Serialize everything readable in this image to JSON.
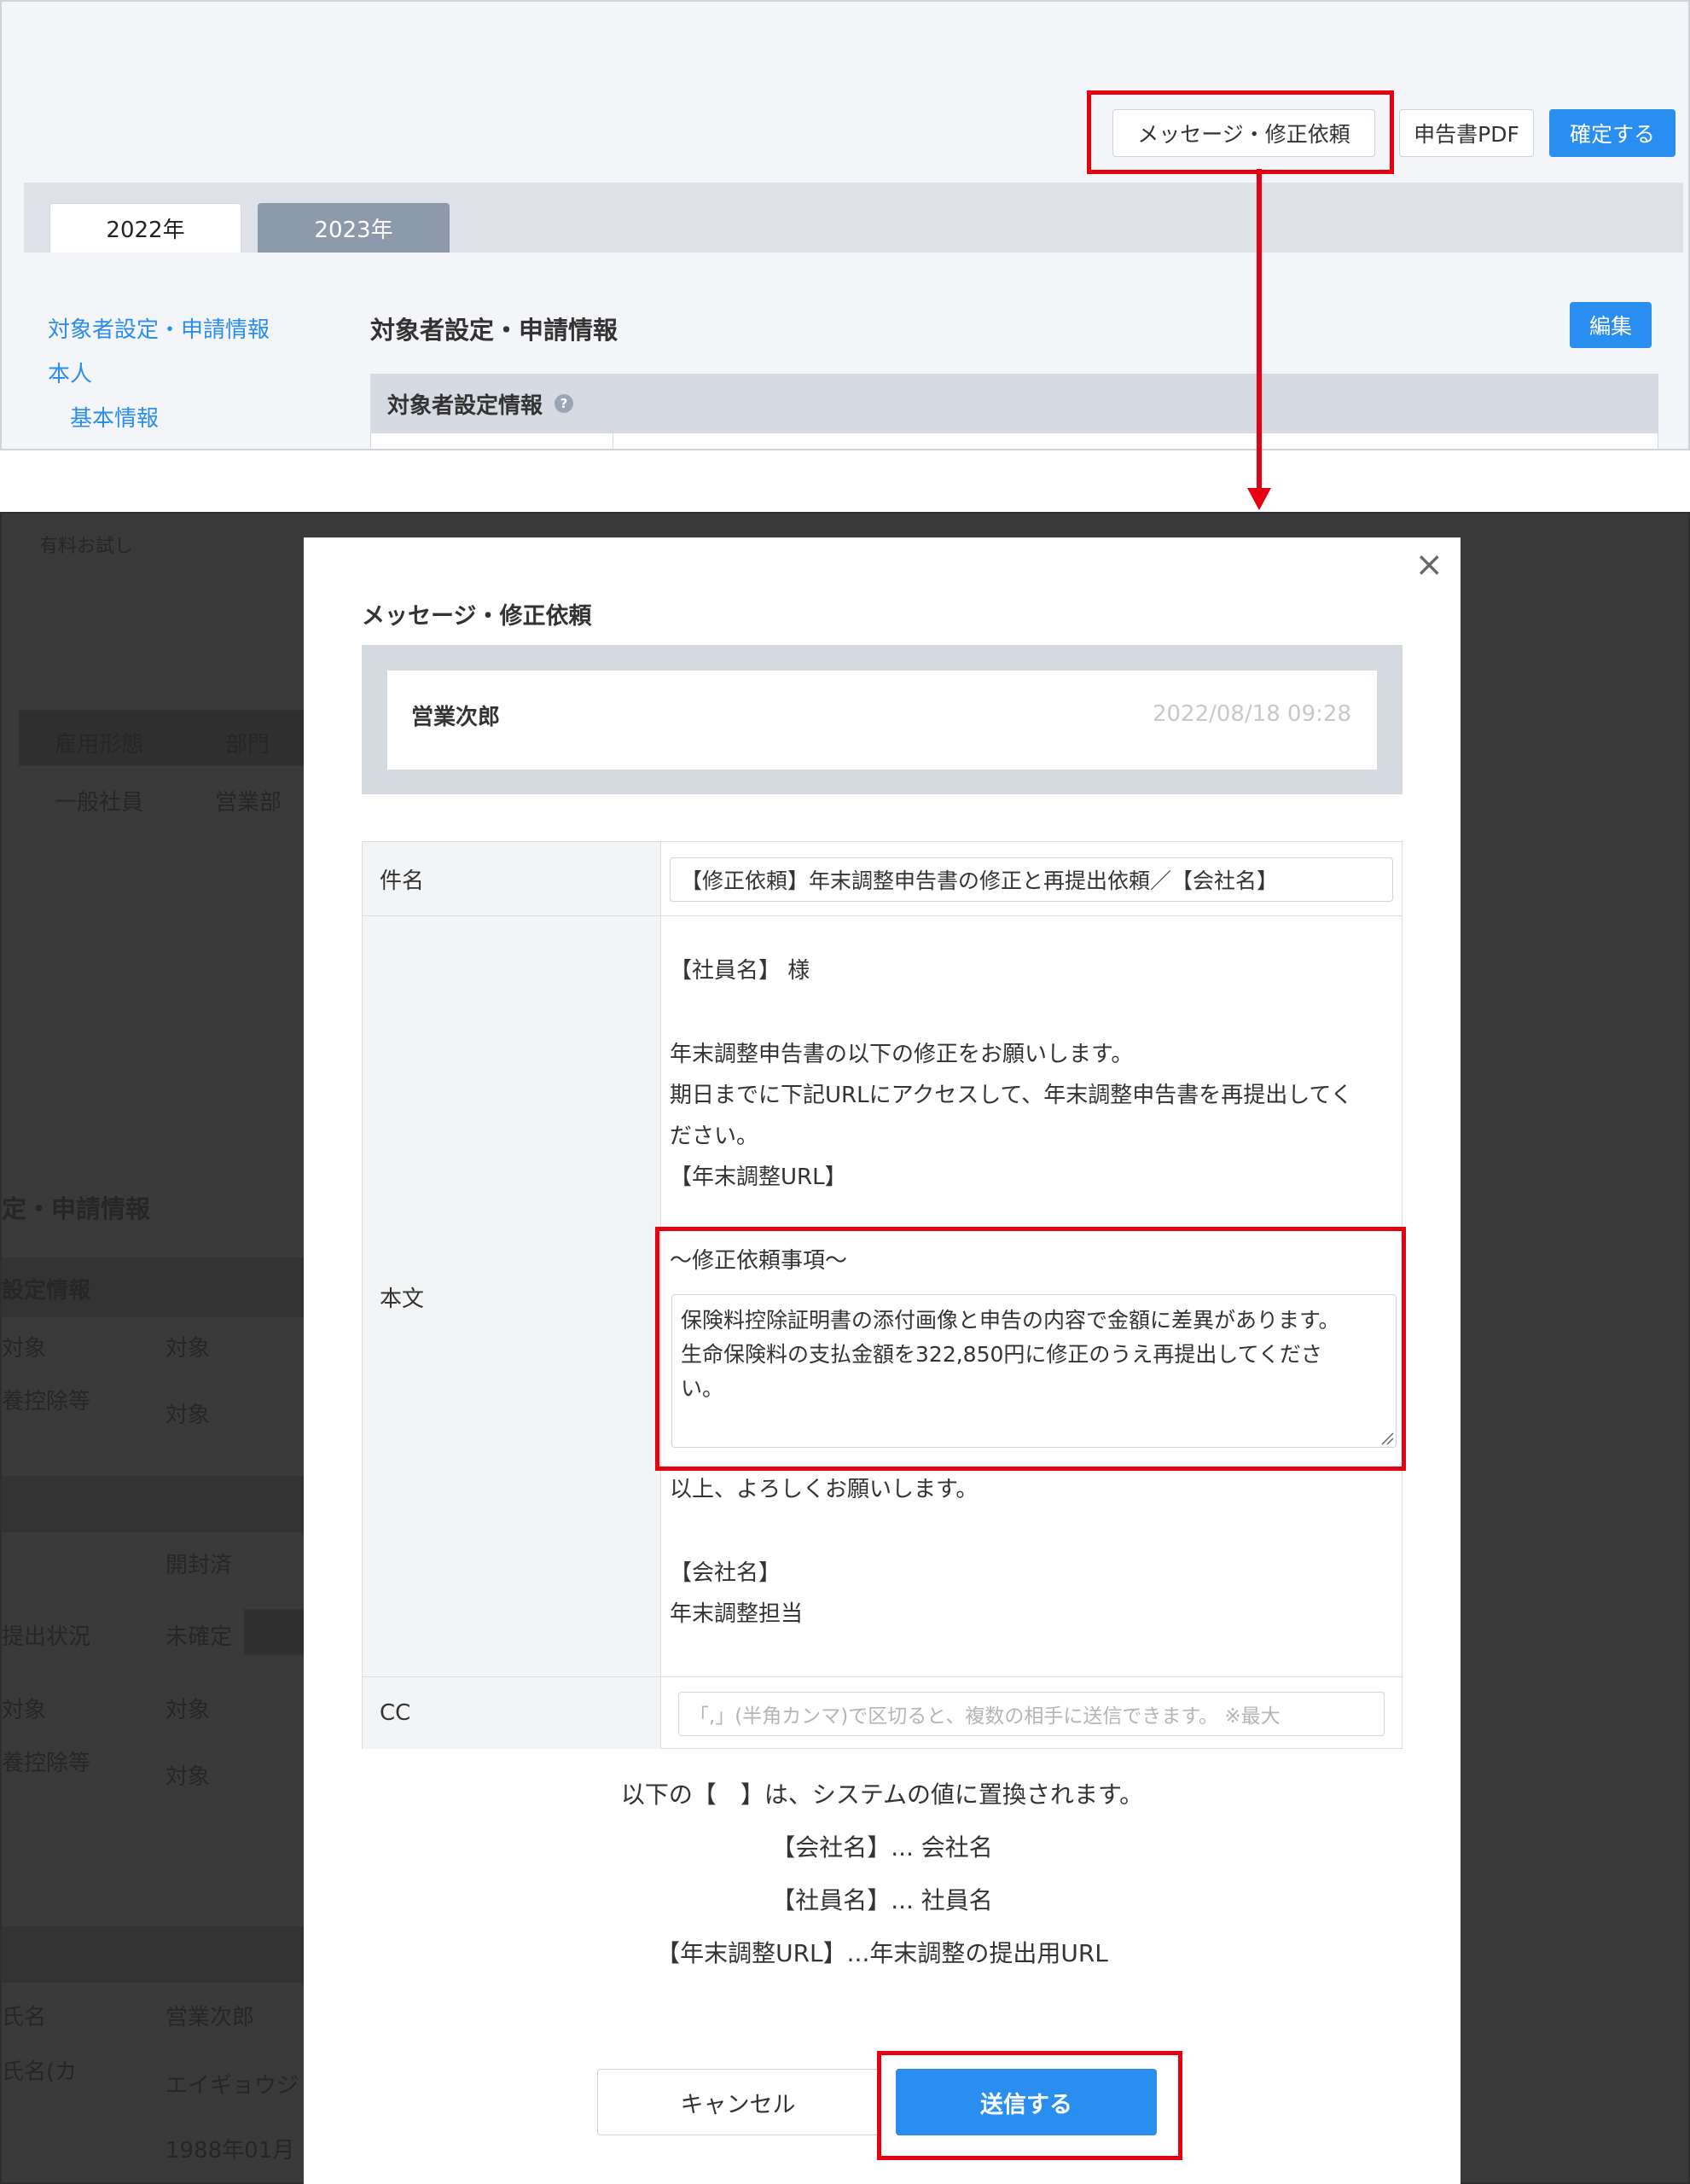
{
  "top": {
    "buttons": {
      "message_request": "メッセージ・修正依頼",
      "pdf": "申告書PDF",
      "confirm": "確定する"
    },
    "year_tabs": [
      "2022年",
      "2023年"
    ],
    "sidebar": [
      "対象者設定・申請情報",
      "本人",
      "基本情報"
    ],
    "section_title": "対象者設定・申請情報",
    "edit_button": "編集",
    "subsection_title": "対象者設定情報",
    "help_icon": "?"
  },
  "background": {
    "trial": "有料お試し",
    "employment_type_header": "雇用形態",
    "department_header": "部門",
    "employment_type_value": "一般社員",
    "department_value": "営業部",
    "section_title_partial": "定・申請情報",
    "subsection_partial": "設定情報",
    "rows": [
      {
        "label": "対象",
        "value": "対象"
      },
      {
        "label": "養控除等",
        "value": "対象"
      },
      {
        "label": "",
        "value": "開封済"
      },
      {
        "label": "提出状況",
        "value": "未確定"
      },
      {
        "label": "対象",
        "value": "対象"
      },
      {
        "label": "養控除等",
        "value": "対象"
      },
      {
        "label": "氏名",
        "value": "営業次郎"
      },
      {
        "label": "氏名(カ",
        "value": "エイギョウジ"
      },
      {
        "label": "",
        "value": "1988年01月"
      }
    ]
  },
  "modal": {
    "title": "メッセージ・修正依頼",
    "close_icon": "×",
    "message": {
      "sender": "営業次郎",
      "timestamp": "2022/08/18 09:28"
    },
    "form": {
      "subject_label": "件名",
      "subject_value": "【修正依頼】年末調整申告書の修正と再提出依頼／【会社名】",
      "body_label": "本文",
      "body_lines": [
        "【社員名】 様",
        "年末調整申告書の以下の修正をお願いします。",
        "期日までに下記URLにアクセスして、年末調整申告書を再提出してく",
        "ださい。",
        "【年末調整URL】",
        "〜修正依頼事項〜"
      ],
      "textarea_lines": [
        "保険料控除証明書の添付画像と申告の内容で金額に差異があります。",
        "生命保険料の支払金額を322,850円に修正のうえ再提出してくださ",
        "い。"
      ],
      "closing_lines": [
        "以上、よろしくお願いします。",
        "【会社名】",
        "年末調整担当"
      ],
      "cc_label": "CC",
      "cc_placeholder": "「,」(半角カンマ)で区切ると、複数の相手に送信できます。 ※最大"
    },
    "notes": [
      "以下の【　】は、システムの値に置換されます。",
      "【会社名】... 会社名",
      "【社員名】... 社員名",
      "【年末調整URL】...年末調整の提出用URL"
    ],
    "cancel_button": "キャンセル",
    "send_button": "送信する"
  }
}
